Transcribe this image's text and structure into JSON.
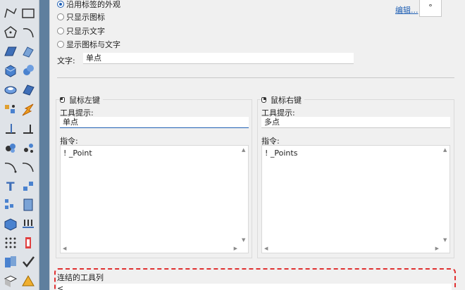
{
  "appearance": {
    "options": [
      {
        "label": "沿用标签的外观",
        "checked": true
      },
      {
        "label": "只显示图标",
        "checked": false
      },
      {
        "label": "只显示文字",
        "checked": false
      },
      {
        "label": "显示图标与文字",
        "checked": false
      }
    ],
    "edit_link": "编辑...",
    "icon_preview_glyph": "°"
  },
  "text_field": {
    "label": "文字:",
    "value": "单点"
  },
  "left_button": {
    "title": "鼠标左键",
    "tooltip_label": "工具提示:",
    "tooltip_value": "单点",
    "command_label": "指令:",
    "command_value": "! _Point"
  },
  "right_button": {
    "title": "鼠标右键",
    "tooltip_label": "工具提示:",
    "tooltip_value": "多点",
    "command_label": "指令:",
    "command_value": "! _Points"
  },
  "linked_toolbar": {
    "label": "连结的工具列",
    "value": "<"
  },
  "colors": {
    "accent": "#1f5fb4",
    "highlight_border": "#e03030",
    "toolbar_bg": "#dfe3e8"
  },
  "toolbar_icons": [
    "polyline-icon",
    "rectangle-icon",
    "polygon-icon",
    "arc-icon",
    "surface-icon",
    "sweep-icon",
    "box-icon",
    "sphere-icon",
    "cylinder-icon",
    "plane-icon",
    "explode-icon",
    "spark-icon",
    "dimension-icon",
    "align-icon",
    "group-icon",
    "points-icon",
    "curve-icon",
    "curve-edit-icon",
    "text-icon",
    "array-icon",
    "grid-icon",
    "scale-icon",
    "solid-icon",
    "pin-icon",
    "dots-grid-icon",
    "measure-icon",
    "panel-icon",
    "check-icon",
    "book-icon",
    "cone-icon"
  ]
}
